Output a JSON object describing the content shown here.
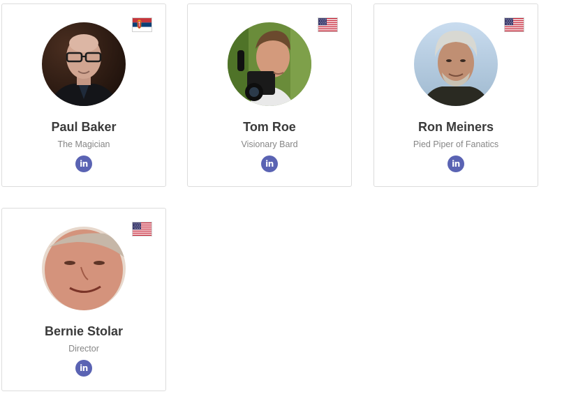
{
  "team": [
    {
      "name": "Paul Baker",
      "role": "The Magician",
      "country_flag": "serbia-flag-icon",
      "linkedin_label": "in"
    },
    {
      "name": "Tom Roe",
      "role": "Visionary Bard",
      "country_flag": "usa-flag-icon",
      "linkedin_label": "in"
    },
    {
      "name": "Ron Meiners",
      "role": "Pied Piper of Fanatics",
      "country_flag": "usa-flag-icon",
      "linkedin_label": "in"
    },
    {
      "name": "Bernie Stolar",
      "role": "Director",
      "country_flag": "usa-flag-icon",
      "linkedin_label": "in"
    }
  ],
  "colors": {
    "linkedin_button": "#5a63b3",
    "name_text": "#3a3a3a",
    "role_text": "#858585",
    "card_border": "#dcdcdc"
  }
}
